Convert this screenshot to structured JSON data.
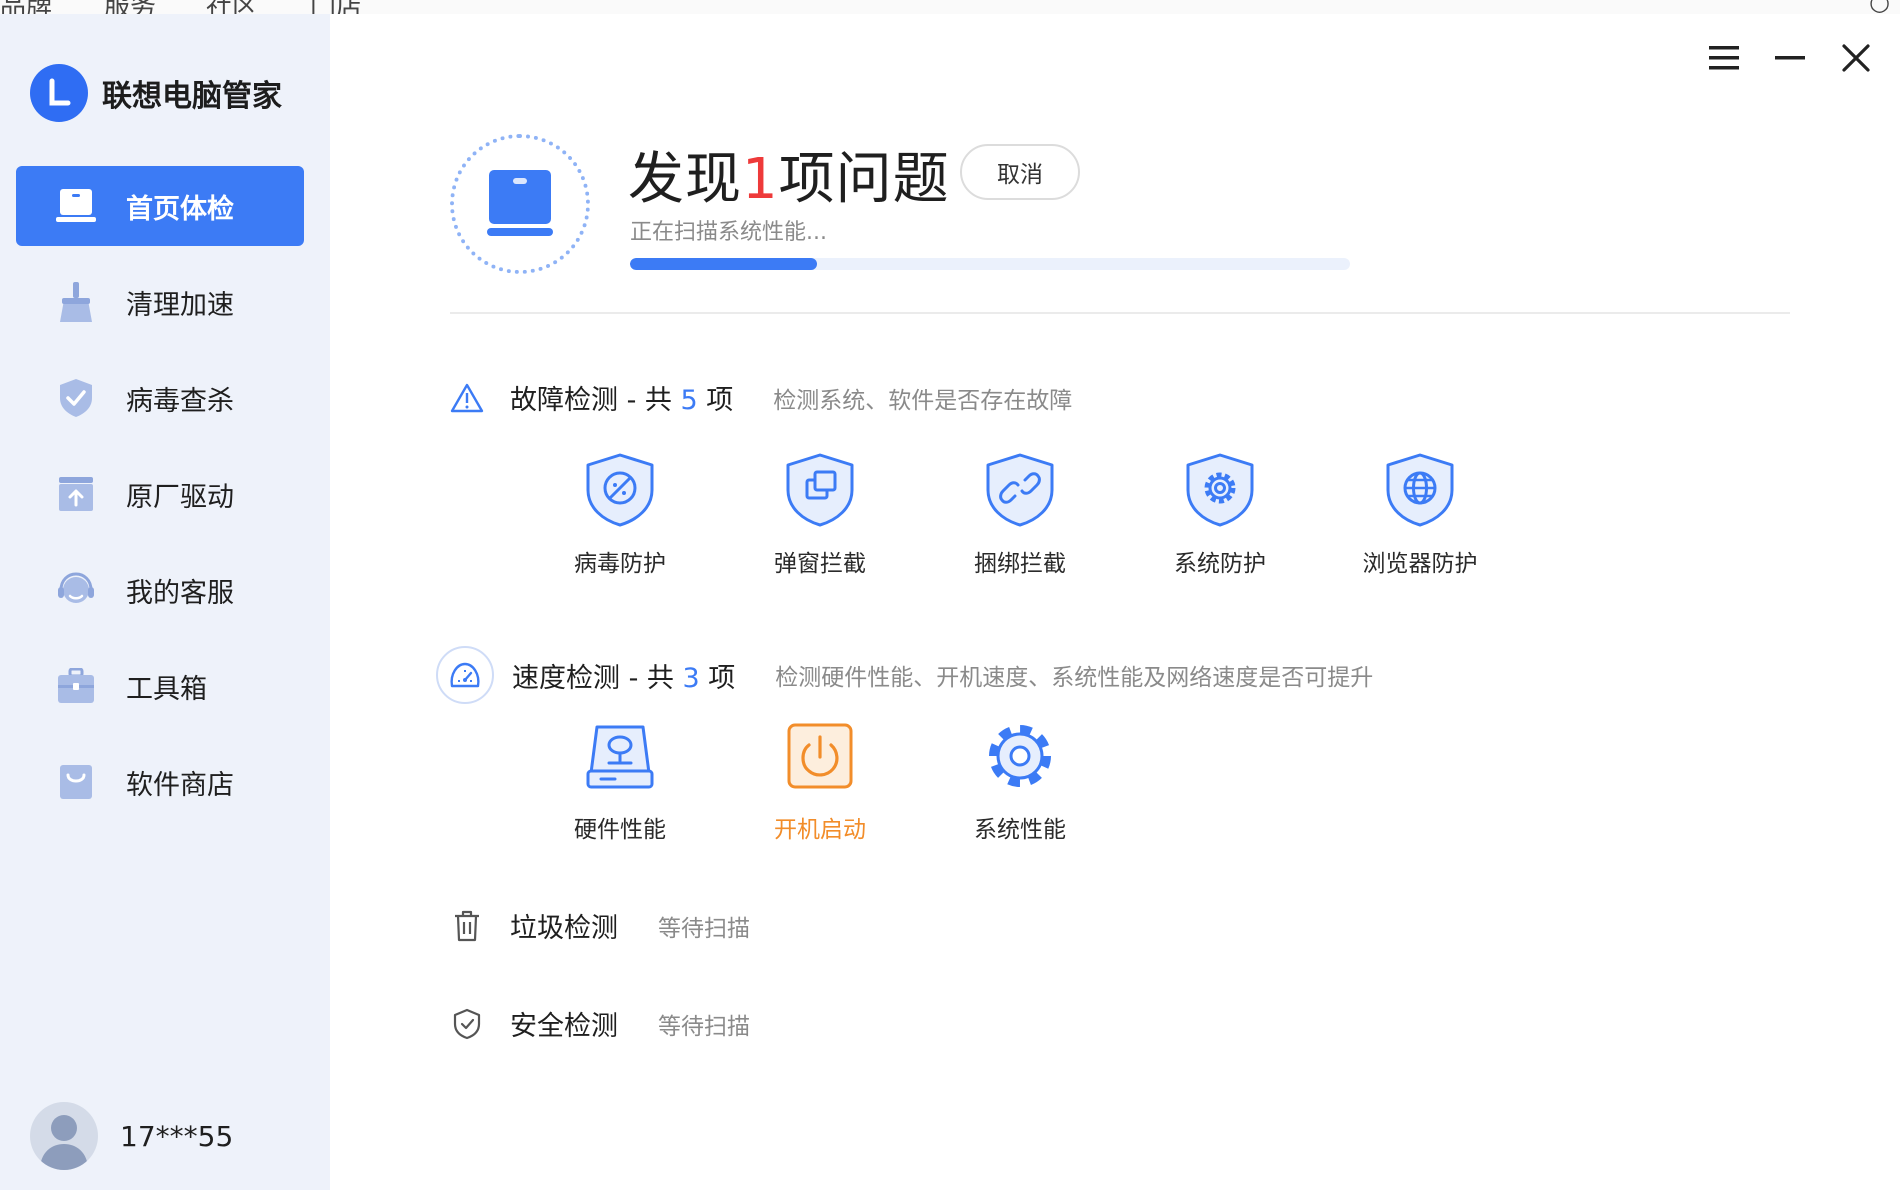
{
  "background": {
    "tabs": [
      "品牌",
      "服务",
      "社区",
      "门店"
    ]
  },
  "app": {
    "name": "联想电脑管家"
  },
  "sidebar": {
    "items": [
      {
        "label": "首页体检",
        "icon": "laptop-icon",
        "active": true
      },
      {
        "label": "清理加速",
        "icon": "broom-icon"
      },
      {
        "label": "病毒查杀",
        "icon": "shield-check-icon"
      },
      {
        "label": "原厂驱动",
        "icon": "upload-box-icon"
      },
      {
        "label": "我的客服",
        "icon": "headset-icon"
      },
      {
        "label": "工具箱",
        "icon": "toolbox-icon"
      },
      {
        "label": "软件商店",
        "icon": "shopping-bag-icon"
      }
    ],
    "user": {
      "name": "17***55"
    }
  },
  "header": {
    "title_prefix": "发现",
    "issue_count": "1",
    "title_suffix": "项问题",
    "cancel_label": "取消",
    "status": "正在扫描系统性能...",
    "progress": 0.26
  },
  "sections": {
    "fault": {
      "title": "故障检测 - 共",
      "count": "5",
      "unit": "项",
      "desc": "检测系统、软件是否存在故障",
      "items": [
        "病毒防护",
        "弹窗拦截",
        "捆绑拦截",
        "系统防护",
        "浏览器防护"
      ]
    },
    "speed": {
      "title": "速度检测 - 共",
      "count": "3",
      "unit": "项",
      "desc": "检测硬件性能、开机速度、系统性能及网络速度是否可提升",
      "items": [
        "硬件性能",
        "开机启动",
        "系统性能"
      ]
    },
    "junk": {
      "title": "垃圾检测",
      "status": "等待扫描"
    },
    "security": {
      "title": "安全检测",
      "status": "等待扫描"
    }
  },
  "colors": {
    "accent": "#3c7bf5",
    "warning": "#f28d2a",
    "issue": "#ee3a3a"
  }
}
